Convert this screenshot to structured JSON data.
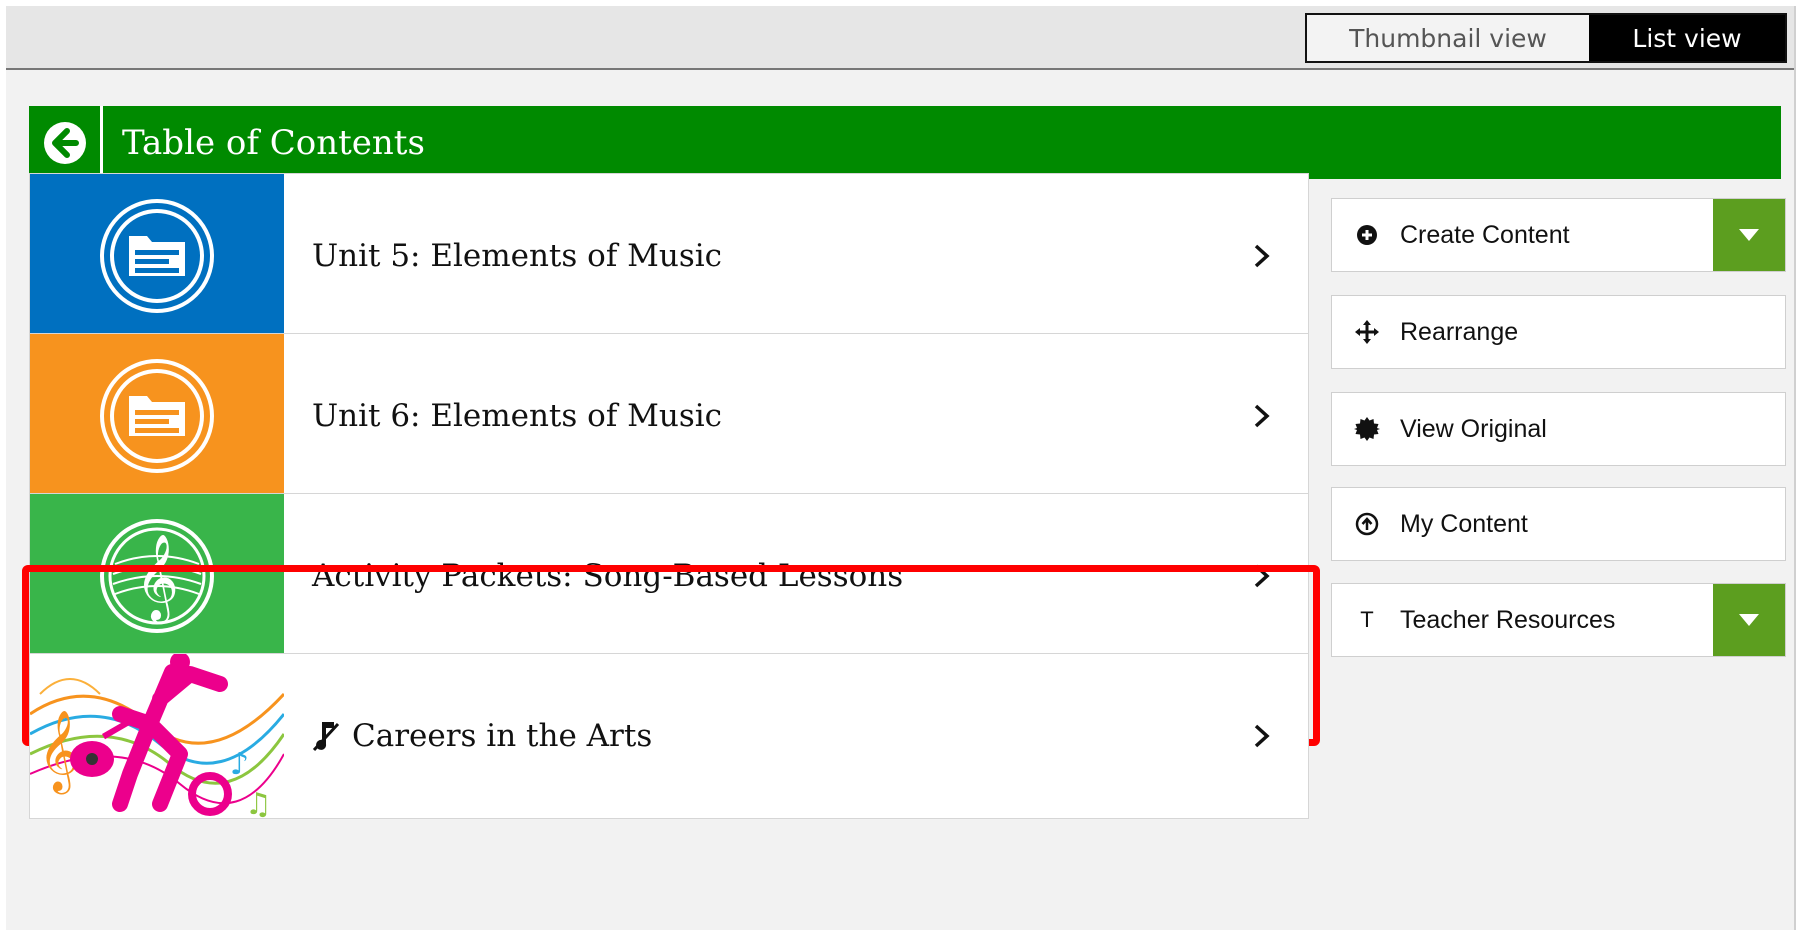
{
  "view_toggle": {
    "thumbnail_label": "Thumbnail view",
    "list_label": "List view",
    "selected": "List view"
  },
  "toc": {
    "title": "Table of Contents"
  },
  "items": [
    {
      "label": "Unit 5: Elements of Music",
      "thumb_color": "#0070c0",
      "icon": "folder-icon"
    },
    {
      "label": "Unit 6: Elements of Music",
      "thumb_color": "#f7931e",
      "icon": "folder-icon"
    },
    {
      "label": "Activity Packets: Song-Based Lessons",
      "thumb_color": "#39b54a",
      "icon": "treble-clef-icon"
    },
    {
      "label": "Careers in the Arts",
      "icon": "music-note-icon"
    }
  ],
  "sidebar": {
    "create_content": "Create Content",
    "rearrange": "Rearrange",
    "view_original": "View Original",
    "my_content": "My Content",
    "teacher_resources": "Teacher Resources",
    "teacher_resources_icon": "T"
  },
  "colors": {
    "header_green": "#008a00",
    "dropdown_green": "#5c9e1f",
    "highlight_red": "#ff0000"
  }
}
